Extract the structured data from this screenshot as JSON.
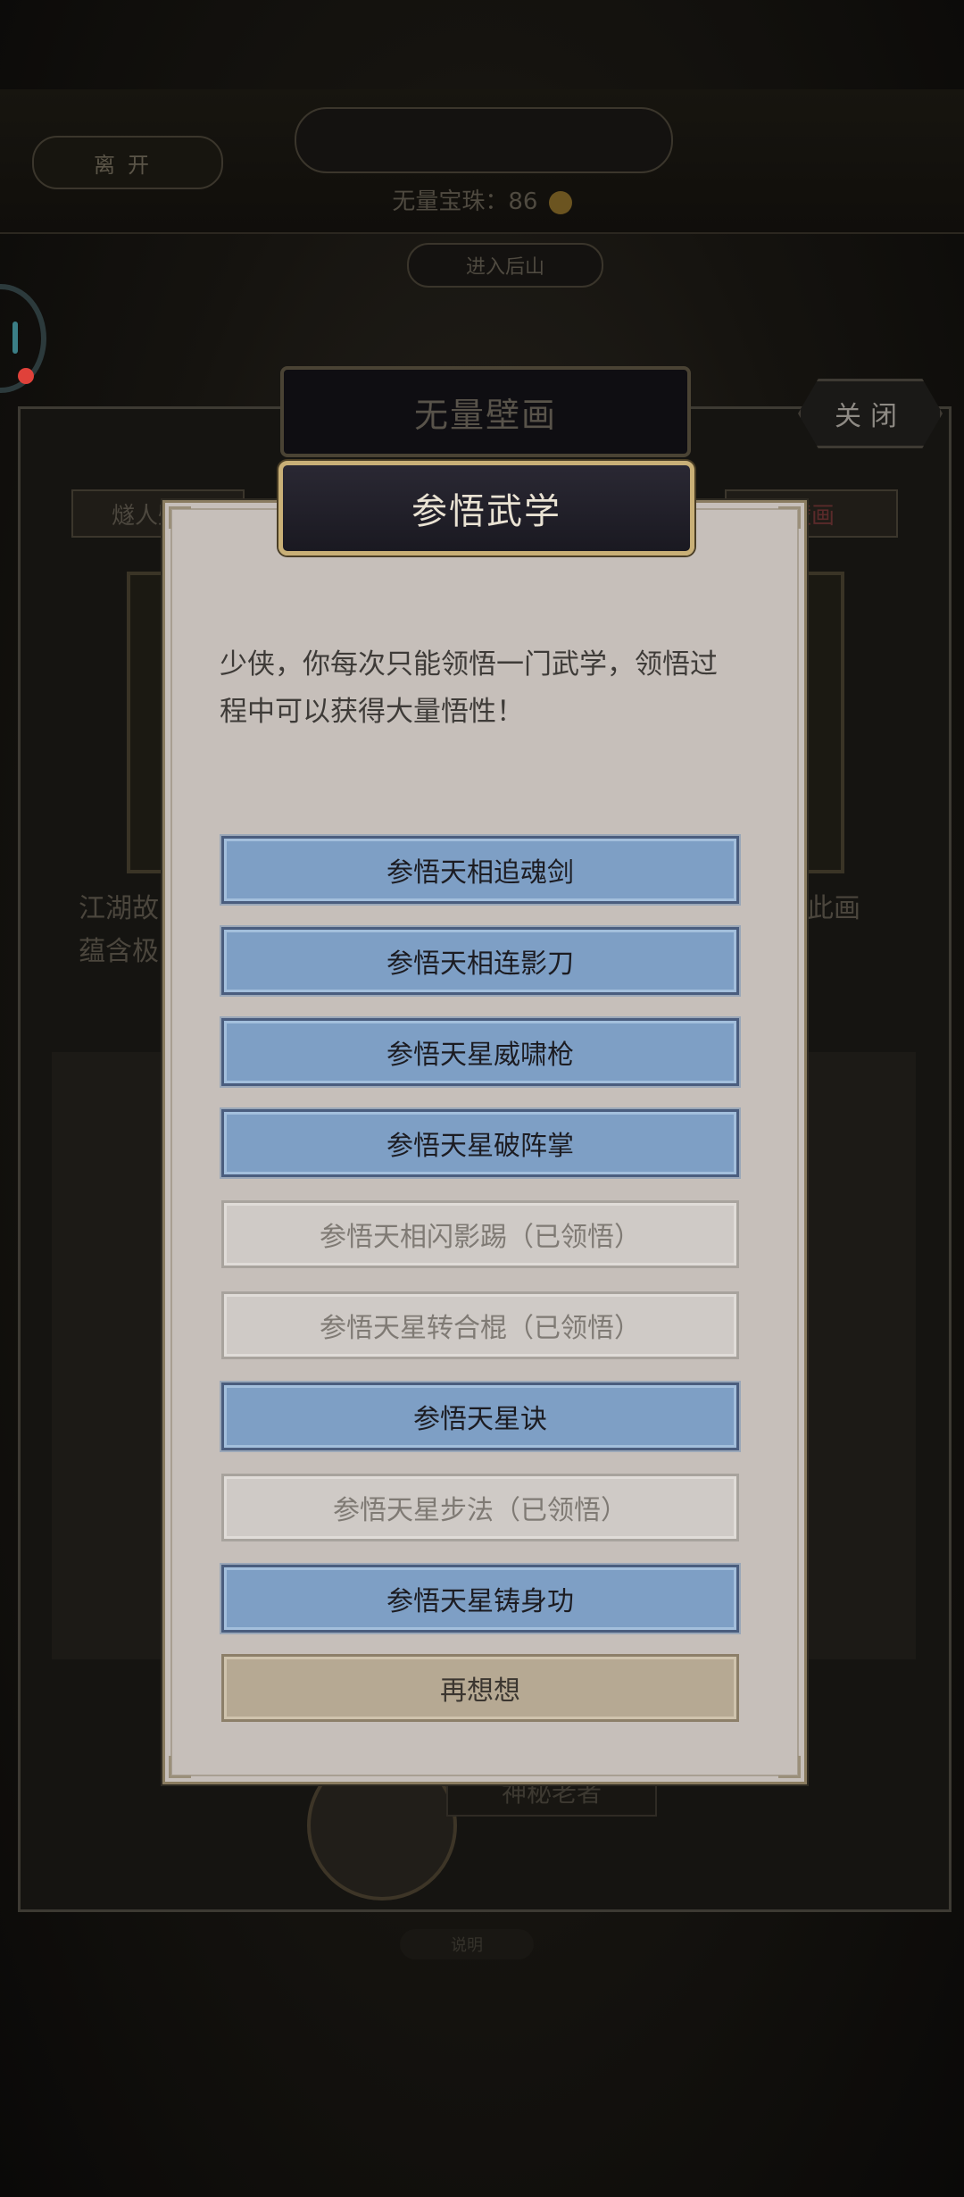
{
  "background": {
    "leave_label": "离开",
    "top_title": "",
    "pearls_label": "无量宝珠：86",
    "enter_label": "进入后山",
    "mural_title": "无量壁画",
    "close_label": "关闭",
    "left_tab": "燧人壁画",
    "right_tab": "壁画",
    "text_left_1": "江湖故",
    "text_left_2": "蕴含极",
    "text_right": "此画",
    "npc_name": "神秘老者",
    "small_label": "说明"
  },
  "modal": {
    "title": "参悟武学",
    "intro": "少侠，你每次只能领悟一门武学，领悟过程中可以获得大量悟性！",
    "options": [
      {
        "label": "参悟天相追魂剑",
        "state": "active"
      },
      {
        "label": "参悟天相连影刀",
        "state": "active"
      },
      {
        "label": "参悟天星威啸枪",
        "state": "active"
      },
      {
        "label": "参悟天星破阵掌",
        "state": "active"
      },
      {
        "label": "参悟天相闪影踢（已领悟）",
        "state": "done"
      },
      {
        "label": "参悟天星转合棍（已领悟）",
        "state": "done"
      },
      {
        "label": "参悟天星诀",
        "state": "active"
      },
      {
        "label": "参悟天星步法（已领悟）",
        "state": "done"
      },
      {
        "label": "参悟天星铸身功",
        "state": "active"
      }
    ],
    "cancel_label": "再想想"
  },
  "colors": {
    "active_option": "#7e9fc5",
    "learned_option": "#cfcac6",
    "cancel_option": "#b6a993",
    "modal_bg": "#c6bfba",
    "title_border": "#c9b077"
  }
}
